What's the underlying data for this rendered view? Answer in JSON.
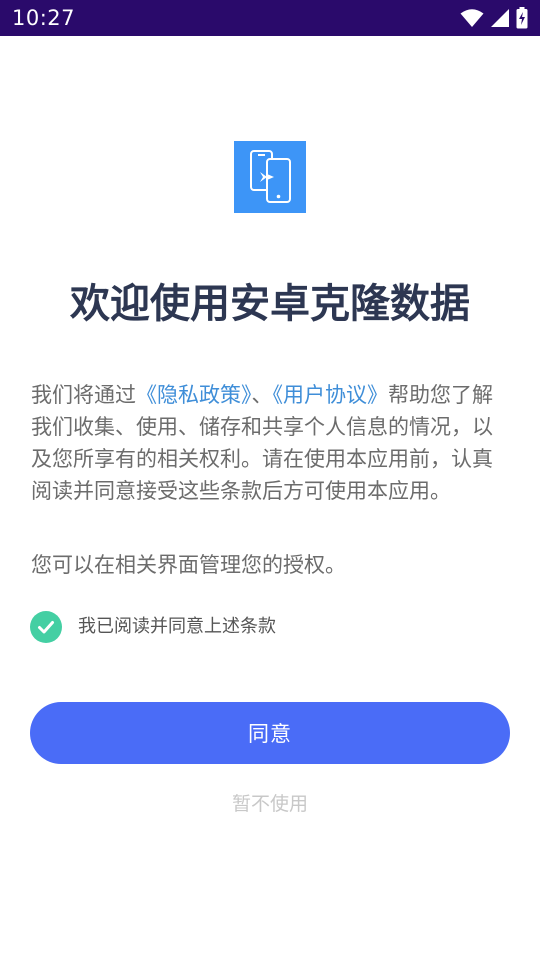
{
  "status_bar": {
    "time": "10:27",
    "icons": [
      "wifi-icon",
      "cellular-signal-icon",
      "battery-charging-icon"
    ],
    "background_color": "#2a0a6b"
  },
  "logo": {
    "icon": "phone-transfer-icon",
    "color": "#3d95f7"
  },
  "title": "欢迎使用安卓克隆数据",
  "intro": {
    "before_privacy": "我们将通过",
    "privacy_link": "《隐私政策》",
    "separator": "、",
    "agreement_link": "《用户协议》",
    "after_links": "帮助您了解我们收集、使用、储存和共享个人信息的情况，以及您所享有的相关权利。请在使用本应用前，认真阅读并同意接受这些条款后方可使用本应用。",
    "link_color": "#3f8ed8"
  },
  "manage_note": "您可以在相关界面管理您的授权。",
  "consent": {
    "checked": true,
    "label": "我已阅读并同意上述条款",
    "check_color": "#44cfa3"
  },
  "buttons": {
    "agree_label": "同意",
    "decline_label": "暂不使用",
    "agree_color": "#4a6cf7"
  }
}
